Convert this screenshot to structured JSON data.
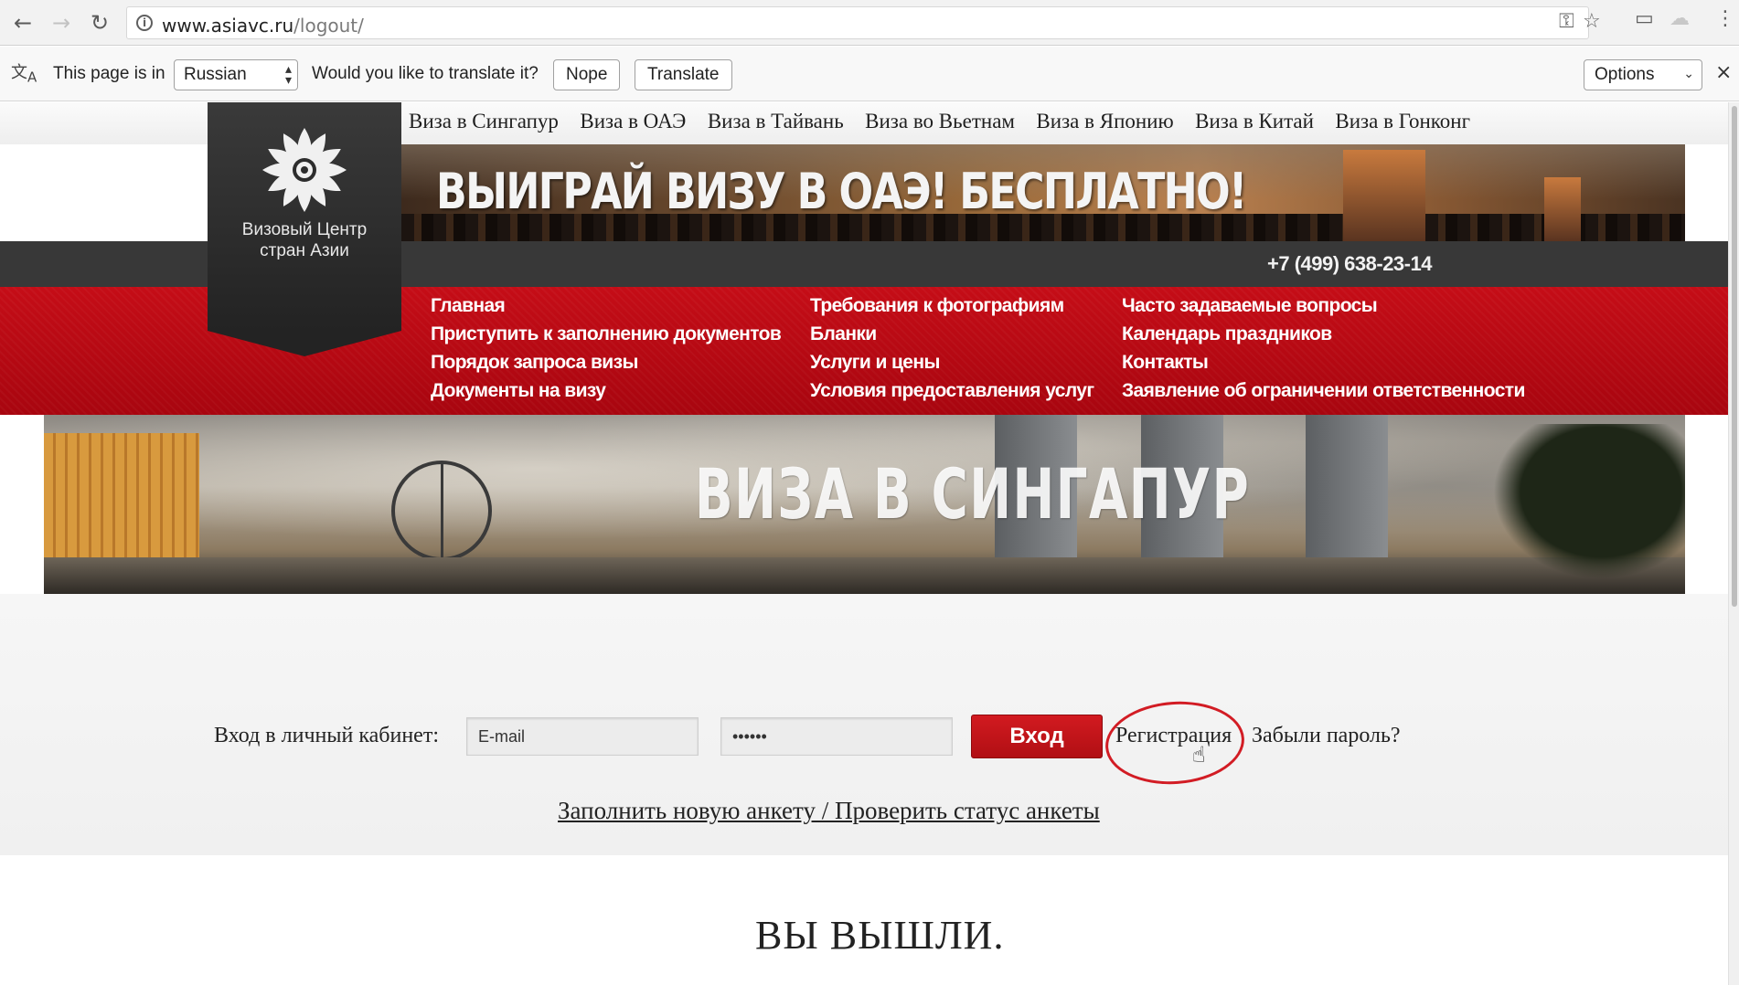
{
  "browser": {
    "url_host": "www.asiavc.ru",
    "url_path": "/logout/"
  },
  "translate_bar": {
    "prefix": "This page is in",
    "language": "Russian",
    "question": "Would you like to translate it?",
    "nope": "Nope",
    "translate": "Translate",
    "options": "Options"
  },
  "site": {
    "logo_line1": "Визовый Центр",
    "logo_line2": "стран Азии",
    "top_links": [
      "Виза в Сингапур",
      "Виза в ОАЭ",
      "Виза в Тайвань",
      "Виза во Вьетнам",
      "Виза в Японию",
      "Виза в Китай",
      "Виза в Гонконг"
    ],
    "promo_title": "ВЫИГРАЙ ВИЗУ В ОАЭ! БЕСПЛАТНО!",
    "phone": "+7 (499) 638-23-14",
    "menu_col1": [
      "Главная",
      "Приступить к заполнению документов",
      "Порядок запроса визы",
      "Документы на визу"
    ],
    "menu_col2": [
      "Требования к фотографиям",
      "Бланки",
      "Услуги и цены",
      "Условия предоставления услуг"
    ],
    "menu_col3": [
      "Часто задаваемые вопросы",
      "Календарь праздников",
      "Контакты",
      "Заявление об ограничении ответственности"
    ],
    "hero_title": "ВИЗА В СИНГАПУР",
    "login": {
      "label": "Вход в личный кабинет:",
      "email_placeholder": "E-mail",
      "password_value": "••••••",
      "login_button": "Вход",
      "register": "Регистрация",
      "forgot": "Забыли пароль?"
    },
    "anketa_link": "Заполнить новую анкету / Проверить статус анкеты",
    "logout_message": "ВЫ ВЫШЛИ."
  },
  "colors": {
    "brand_red": "#c50d17",
    "dark_band": "#383838",
    "annotation_red": "#d21c24"
  }
}
